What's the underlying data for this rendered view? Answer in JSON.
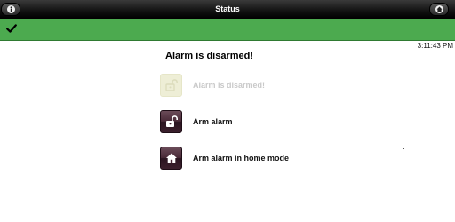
{
  "header": {
    "title": "Status",
    "info_icon": "info-icon",
    "home_icon": "home-icon"
  },
  "statusbar": {
    "icon": "checkmark-icon",
    "color": "#4caa4f"
  },
  "clock": "3:11:43 PM",
  "main": {
    "heading": "Alarm is disarmed!",
    "items": [
      {
        "label": "Alarm is disarmed!",
        "icon": "unlocked-padlock-icon",
        "enabled": false
      },
      {
        "label": "Arm alarm",
        "icon": "padlock-icon",
        "enabled": true
      },
      {
        "label": "Arm alarm in home mode",
        "icon": "house-icon",
        "enabled": true
      }
    ]
  },
  "colors": {
    "header_bg": "#000000",
    "status_green": "#4caa4f",
    "button_bg": "#4a2a38"
  }
}
